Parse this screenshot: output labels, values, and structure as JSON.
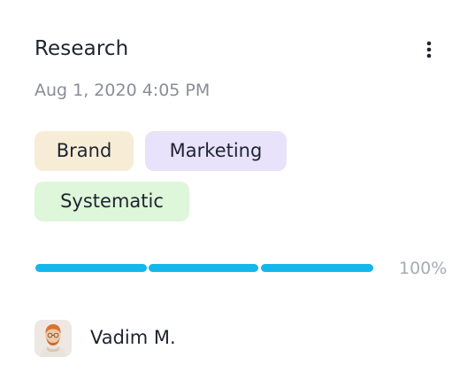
{
  "card": {
    "title": "Research",
    "date": "Aug 1, 2020 4:05 PM",
    "menu_icon": "more-vertical-icon",
    "tags": [
      {
        "label": "Brand",
        "color": "#f7ecd6"
      },
      {
        "label": "Marketing",
        "color": "#e9e2fb"
      },
      {
        "label": "Systematic",
        "color": "#def6da"
      }
    ],
    "progress": {
      "value": 1.0,
      "label": "100%",
      "segments": 3,
      "fill_color": "#14b7ec"
    },
    "assignee": {
      "name": "Vadim M.",
      "avatar_icon": "user-avatar"
    }
  }
}
